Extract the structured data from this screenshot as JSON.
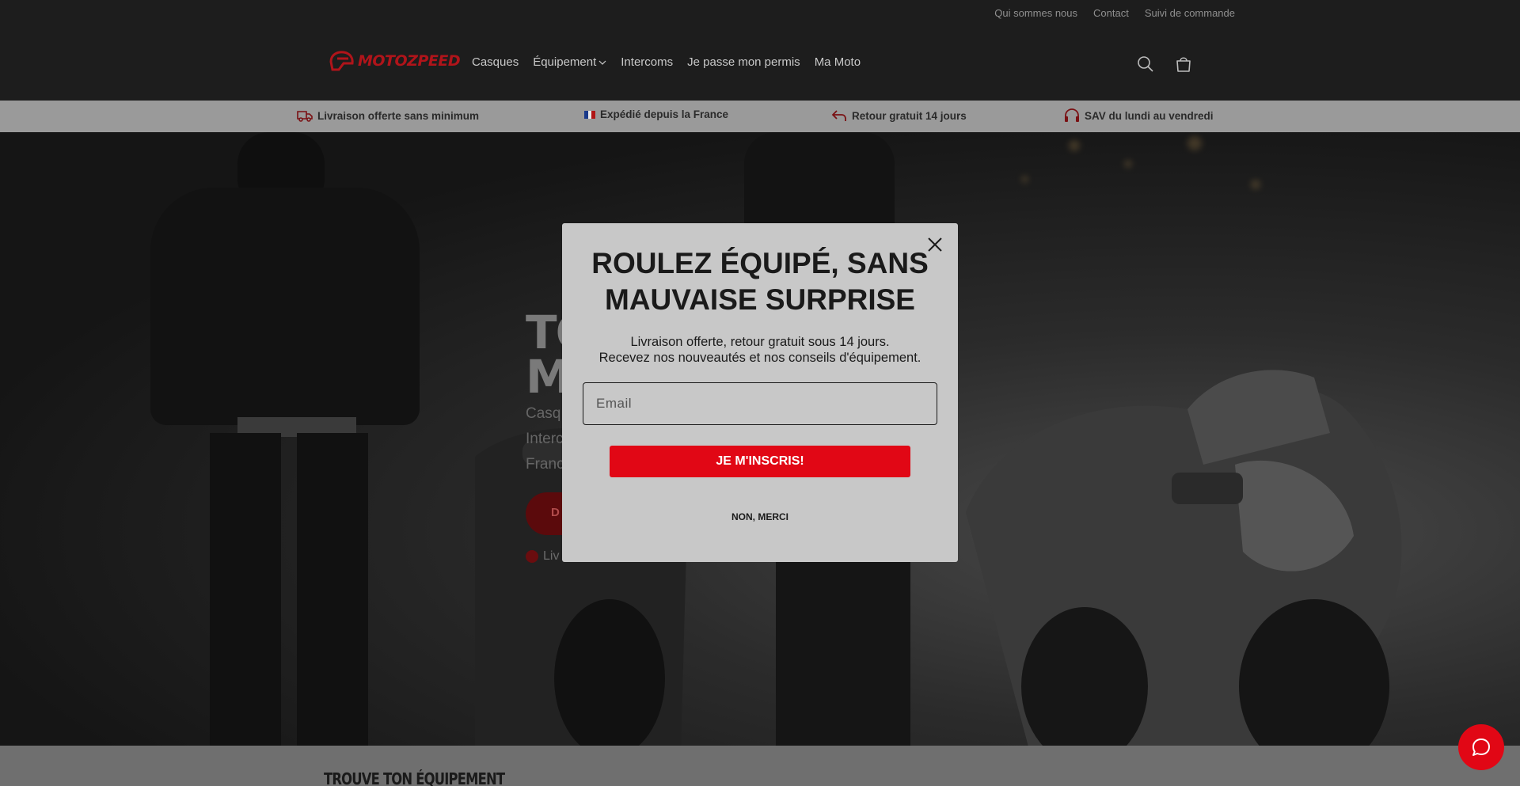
{
  "utility_nav": [
    "Qui sommes nous",
    "Contact",
    "Suivi de commande"
  ],
  "logo": {
    "text": "MOTOZPEED"
  },
  "main_nav": [
    {
      "label": "Casques"
    },
    {
      "label": "Équipement",
      "has_dropdown": true
    },
    {
      "label": "Intercoms"
    },
    {
      "label": "Je passe mon permis"
    },
    {
      "label": "Ma Moto"
    }
  ],
  "header_icons": [
    "search-icon",
    "cart-icon"
  ],
  "benefits": [
    {
      "icon": "truck-icon",
      "text": "Livraison offerte sans minimum"
    },
    {
      "icon": "french-flag-icon",
      "text": "Expédié depuis la France"
    },
    {
      "icon": "return-arrow-icon",
      "text": "Retour gratuit 14 jours"
    },
    {
      "icon": "headset-icon",
      "text": "SAV du lundi au vendredi"
    }
  ],
  "hero": {
    "title_line1": "TO",
    "title_line2": "MO",
    "sub_line1": "Casq",
    "sub_line2": "Interc",
    "sub_line3": "Franc",
    "cta_label": "D",
    "note": "Liv"
  },
  "section_title": "TROUVE TON ÉQUIPEMENT",
  "popup": {
    "title_line1": "ROULEZ ÉQUIPÉ, SANS",
    "title_line2": "MAUVAISE SURPRISE",
    "text_line1": "Livraison offerte, retour gratuit sous 14 jours.",
    "text_line2": "Recevez nos nouveautés et nos conseils d'équipement.",
    "email_placeholder": "Email",
    "submit_label": "JE M'INSCRIS!",
    "decline_label": "NON, MERCI"
  },
  "colors": {
    "accent": "#e10715",
    "header_bg": "#1d1d1d",
    "popup_bg": "#c8c8c8"
  }
}
